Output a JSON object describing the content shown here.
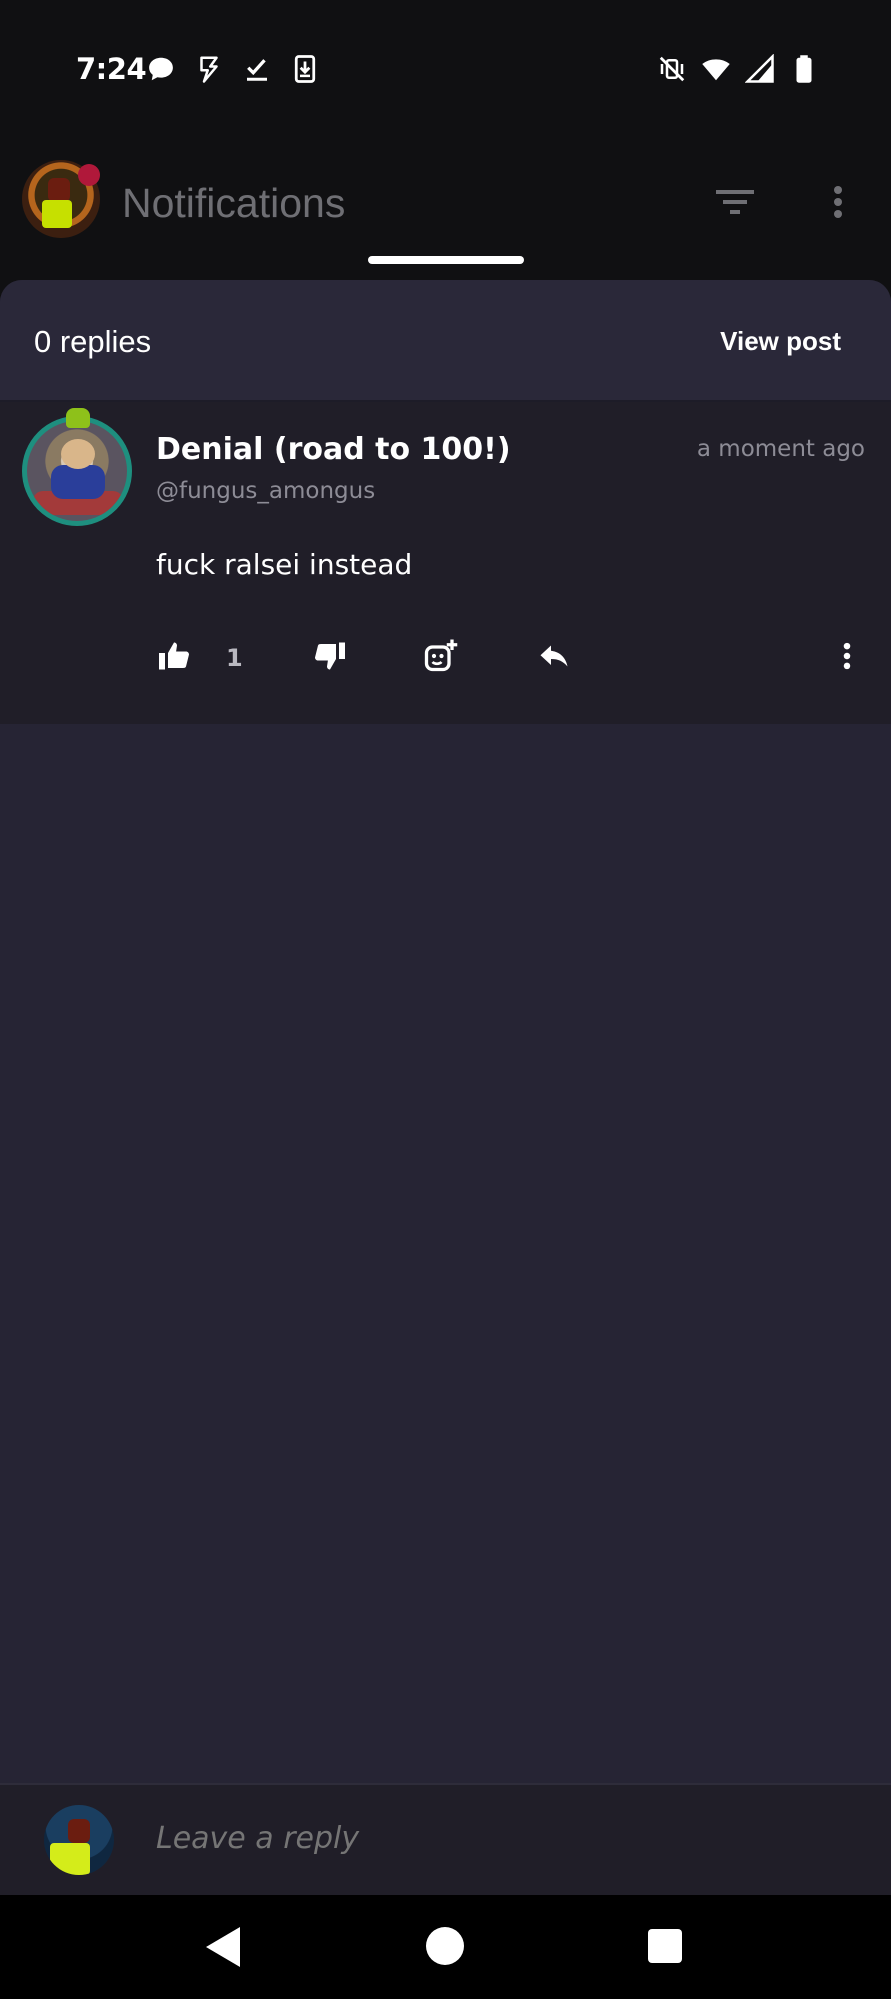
{
  "status_bar": {
    "time": "7:24",
    "left_icons": [
      "chat-bubble-icon",
      "flash-icon",
      "check-icon",
      "download-phone-icon"
    ],
    "right_icons": [
      "vibrate-mute-icon",
      "wifi-icon",
      "signal-icon",
      "battery-icon"
    ]
  },
  "app_bar": {
    "title": "Notifications"
  },
  "sheet": {
    "replies_count": "0 replies",
    "view_post_label": "View post"
  },
  "comment": {
    "author_name": "Denial (road to 100!)",
    "author_handle": "@fungus_amongus",
    "timestamp": "a moment ago",
    "body": "fuck ralsei instead",
    "like_count": "1"
  },
  "reply_bar": {
    "placeholder": "Leave a reply"
  },
  "colors": {
    "sheet_bg": "#262434",
    "comment_bg": "#201e28",
    "avatar_ring": "#1e8f7f",
    "muted_text": "#8d8c96"
  }
}
